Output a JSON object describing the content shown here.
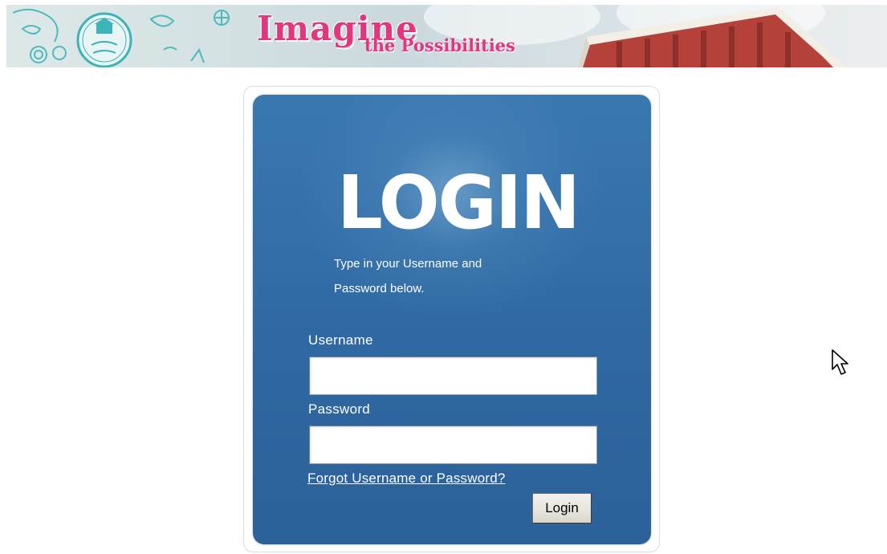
{
  "banner": {
    "headline_big": "Imagine",
    "headline_small": "the Possibilities",
    "logo_name": "university-prep-logo",
    "accent_color": "#e4367e"
  },
  "login": {
    "title": "LOGIN",
    "instructions_line1": "Type in your Username and",
    "instructions_line2": "Password below.",
    "username_label": "Username",
    "username_value": "",
    "password_label": "Password",
    "password_value": "",
    "forgot_link": "Forgot Username or Password?",
    "submit_label": "Login",
    "card_color": "#2f67a0"
  },
  "icons": {
    "cursor": "mouse-pointer-icon"
  }
}
